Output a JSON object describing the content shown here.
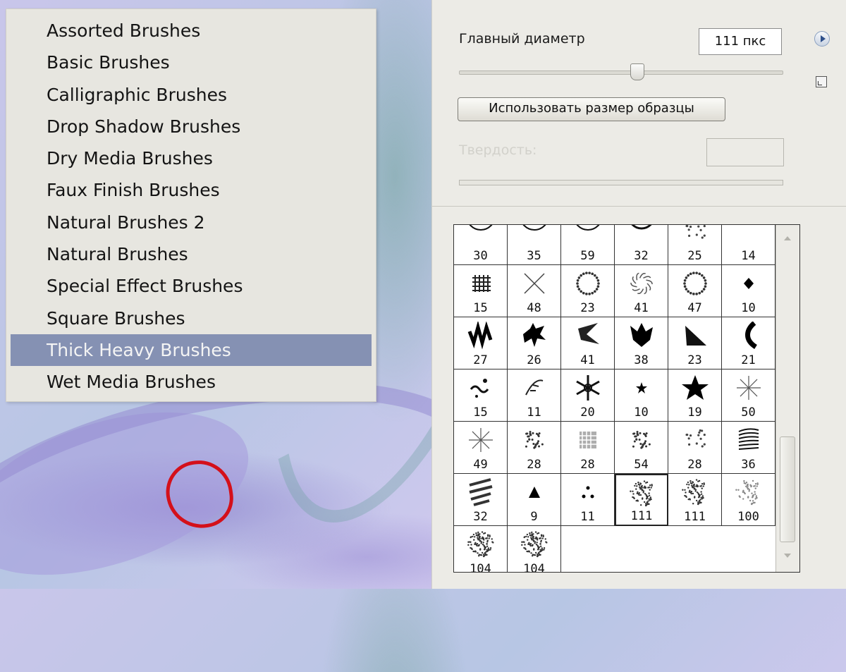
{
  "brush_menu": {
    "items": [
      {
        "label": "Assorted Brushes"
      },
      {
        "label": "Basic Brushes"
      },
      {
        "label": "Calligraphic Brushes"
      },
      {
        "label": "Drop Shadow Brushes"
      },
      {
        "label": "Dry Media Brushes"
      },
      {
        "label": "Faux Finish Brushes"
      },
      {
        "label": "Natural Brushes 2"
      },
      {
        "label": "Natural Brushes"
      },
      {
        "label": "Special Effect Brushes"
      },
      {
        "label": "Square Brushes"
      },
      {
        "label": "Thick Heavy Brushes",
        "selected": true
      },
      {
        "label": "Wet Media Brushes"
      }
    ]
  },
  "brush_panel": {
    "master_diameter_label": "Главный диаметр",
    "master_diameter_value": "111 пкс",
    "master_diameter_slider_fraction": 0.55,
    "use_sample_size_label": "Использовать размер образцы",
    "hardness_label": "Твердость:",
    "hardness_value": "",
    "menu_icon": "circle-arrow-right-icon",
    "new_preset_icon": "new-preset-icon",
    "selected_brush_index": 33,
    "brushes": [
      {
        "size": "30",
        "icon": "circle"
      },
      {
        "size": "35",
        "icon": "circle"
      },
      {
        "size": "59",
        "icon": "circle"
      },
      {
        "size": "32",
        "icon": "ring"
      },
      {
        "size": "25",
        "icon": "scatter"
      },
      {
        "size": "14",
        "icon": "strokes"
      },
      {
        "size": "15",
        "icon": "hash"
      },
      {
        "size": "48",
        "icon": "cross"
      },
      {
        "size": "23",
        "icon": "dotted-ring"
      },
      {
        "size": "41",
        "icon": "swirl"
      },
      {
        "size": "47",
        "icon": "dotted-ring"
      },
      {
        "size": "10",
        "icon": "diamond"
      },
      {
        "size": "27",
        "icon": "zigzag"
      },
      {
        "size": "26",
        "icon": "splash"
      },
      {
        "size": "41",
        "icon": "chevron"
      },
      {
        "size": "38",
        "icon": "blot"
      },
      {
        "size": "23",
        "icon": "wedge"
      },
      {
        "size": "21",
        "icon": "curve"
      },
      {
        "size": "15",
        "icon": "squiggle"
      },
      {
        "size": "11",
        "icon": "leaf"
      },
      {
        "size": "20",
        "icon": "snowflake"
      },
      {
        "size": "10",
        "icon": "small-star"
      },
      {
        "size": "19",
        "icon": "star"
      },
      {
        "size": "50",
        "icon": "burst"
      },
      {
        "size": "49",
        "icon": "burst"
      },
      {
        "size": "28",
        "icon": "speckle"
      },
      {
        "size": "28",
        "icon": "grid-blur"
      },
      {
        "size": "54",
        "icon": "speckle"
      },
      {
        "size": "28",
        "icon": "scatter"
      },
      {
        "size": "36",
        "icon": "feather"
      },
      {
        "size": "32",
        "icon": "streaks"
      },
      {
        "size": "9",
        "icon": "triangle"
      },
      {
        "size": "11",
        "icon": "three-dots"
      },
      {
        "size": "111",
        "icon": "noise"
      },
      {
        "size": "111",
        "icon": "noise"
      },
      {
        "size": "100",
        "icon": "noise-light"
      },
      {
        "size": "104",
        "icon": "noise-dense"
      },
      {
        "size": "104",
        "icon": "noise-dense"
      }
    ]
  }
}
